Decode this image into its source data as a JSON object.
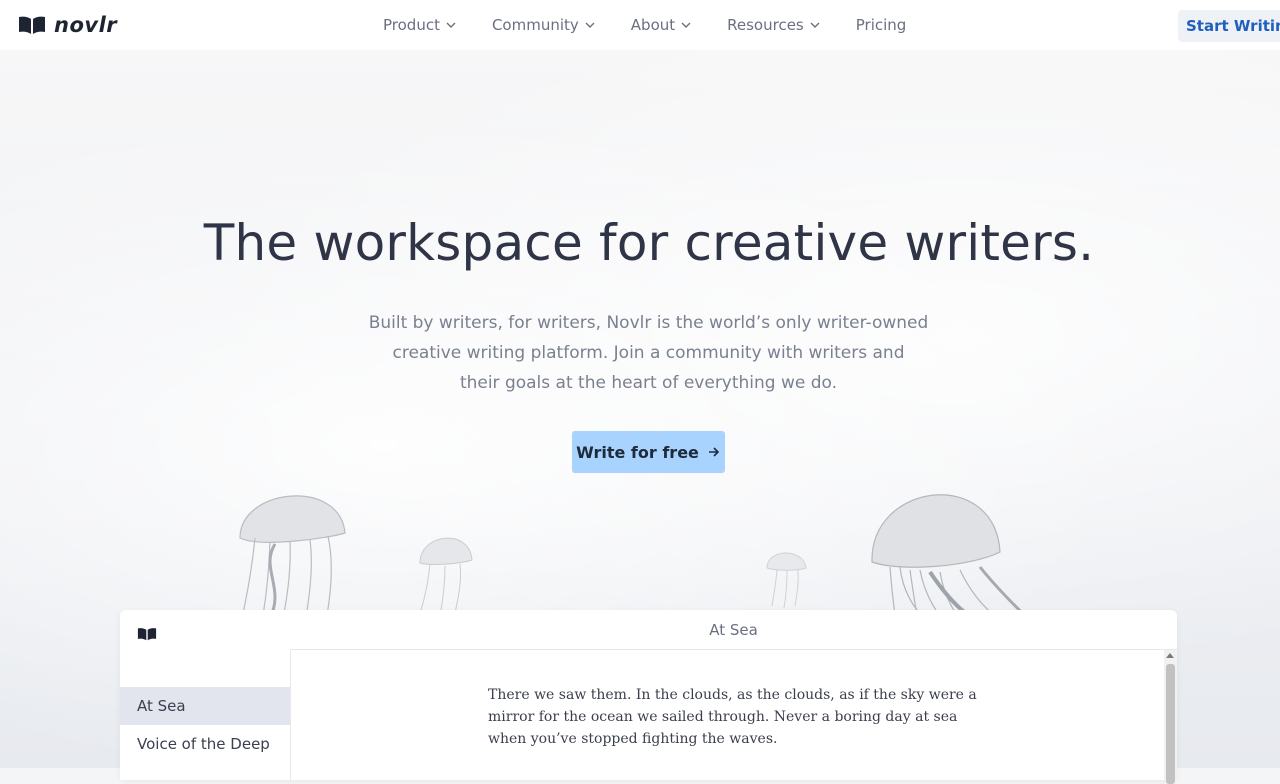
{
  "brand": {
    "name": "novlr",
    "icon": "open-book-icon"
  },
  "nav": {
    "items": [
      {
        "label": "Product",
        "has_dropdown": true
      },
      {
        "label": "Community",
        "has_dropdown": true
      },
      {
        "label": "About",
        "has_dropdown": true
      },
      {
        "label": "Resources",
        "has_dropdown": true
      },
      {
        "label": "Pricing",
        "has_dropdown": false
      }
    ],
    "cta_label": "Start Writing"
  },
  "hero": {
    "title": "The workspace for creative writers.",
    "subtitle_lines": [
      "Built by writers, for writers, Novlr is the world’s only writer-owned",
      "creative writing platform. Join a community with writers and",
      "their goals at the heart of everything we do."
    ],
    "button_label": "Write for free",
    "button_icon": "arrow-right-icon"
  },
  "app_preview": {
    "doc_title": "At Sea",
    "sidebar_items": [
      {
        "label": "At Sea",
        "active": true
      },
      {
        "label": "Voice of the Deep",
        "active": false
      }
    ],
    "body_lines": [
      "There we saw them. In the clouds, as the clouds, as if the sky were a",
      "mirror for the ocean we sailed through. Never a boring day at sea",
      "when you’ve stopped fighting the waves."
    ]
  },
  "colors": {
    "accent": "#a9d3ff",
    "link": "#1f5fbf",
    "heading": "#2f3546",
    "muted": "#7a8090"
  }
}
